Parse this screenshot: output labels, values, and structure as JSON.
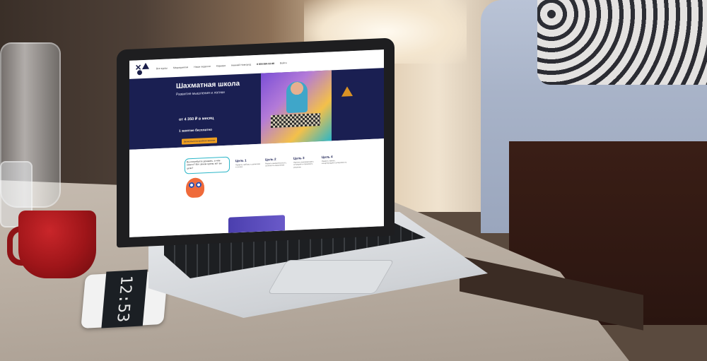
{
  "phone": {
    "clock": "12:53"
  },
  "site": {
    "nav": [
      "Все курсы",
      "Мероприятия",
      "Наши педагоги",
      "Карьера"
    ],
    "city": "Нижний Новгород",
    "phone": "8 800 550-32-98",
    "login": "Войти",
    "hero": {
      "title": "Шахматная школа",
      "subtitle": "Развитие мышления и логики",
      "price": "от 4 350 ₽ в месяц",
      "free": "1 занятие бесплатно",
      "cta": "Записаться на пробное занятие"
    },
    "bubble": "Вы потребуете доказать, в чем смысл? Вот зачем нужны вот вы цели?",
    "goals": [
      {
        "title": "Цель 1",
        "text": "Привить любовь к шахматам и логике"
      },
      {
        "title": "Цель 2",
        "text": "Развить внимательность, логичность мышления"
      },
      {
        "title": "Цель 3",
        "text": "Научить анализировать ситуацию и принимать решения"
      },
      {
        "title": "Цель 4",
        "text": "Развить память, концентрацию и усидчивость"
      }
    ]
  },
  "colors": {
    "navy": "#1a1f52",
    "orange": "#f0a020",
    "mug": "#b01c20"
  }
}
